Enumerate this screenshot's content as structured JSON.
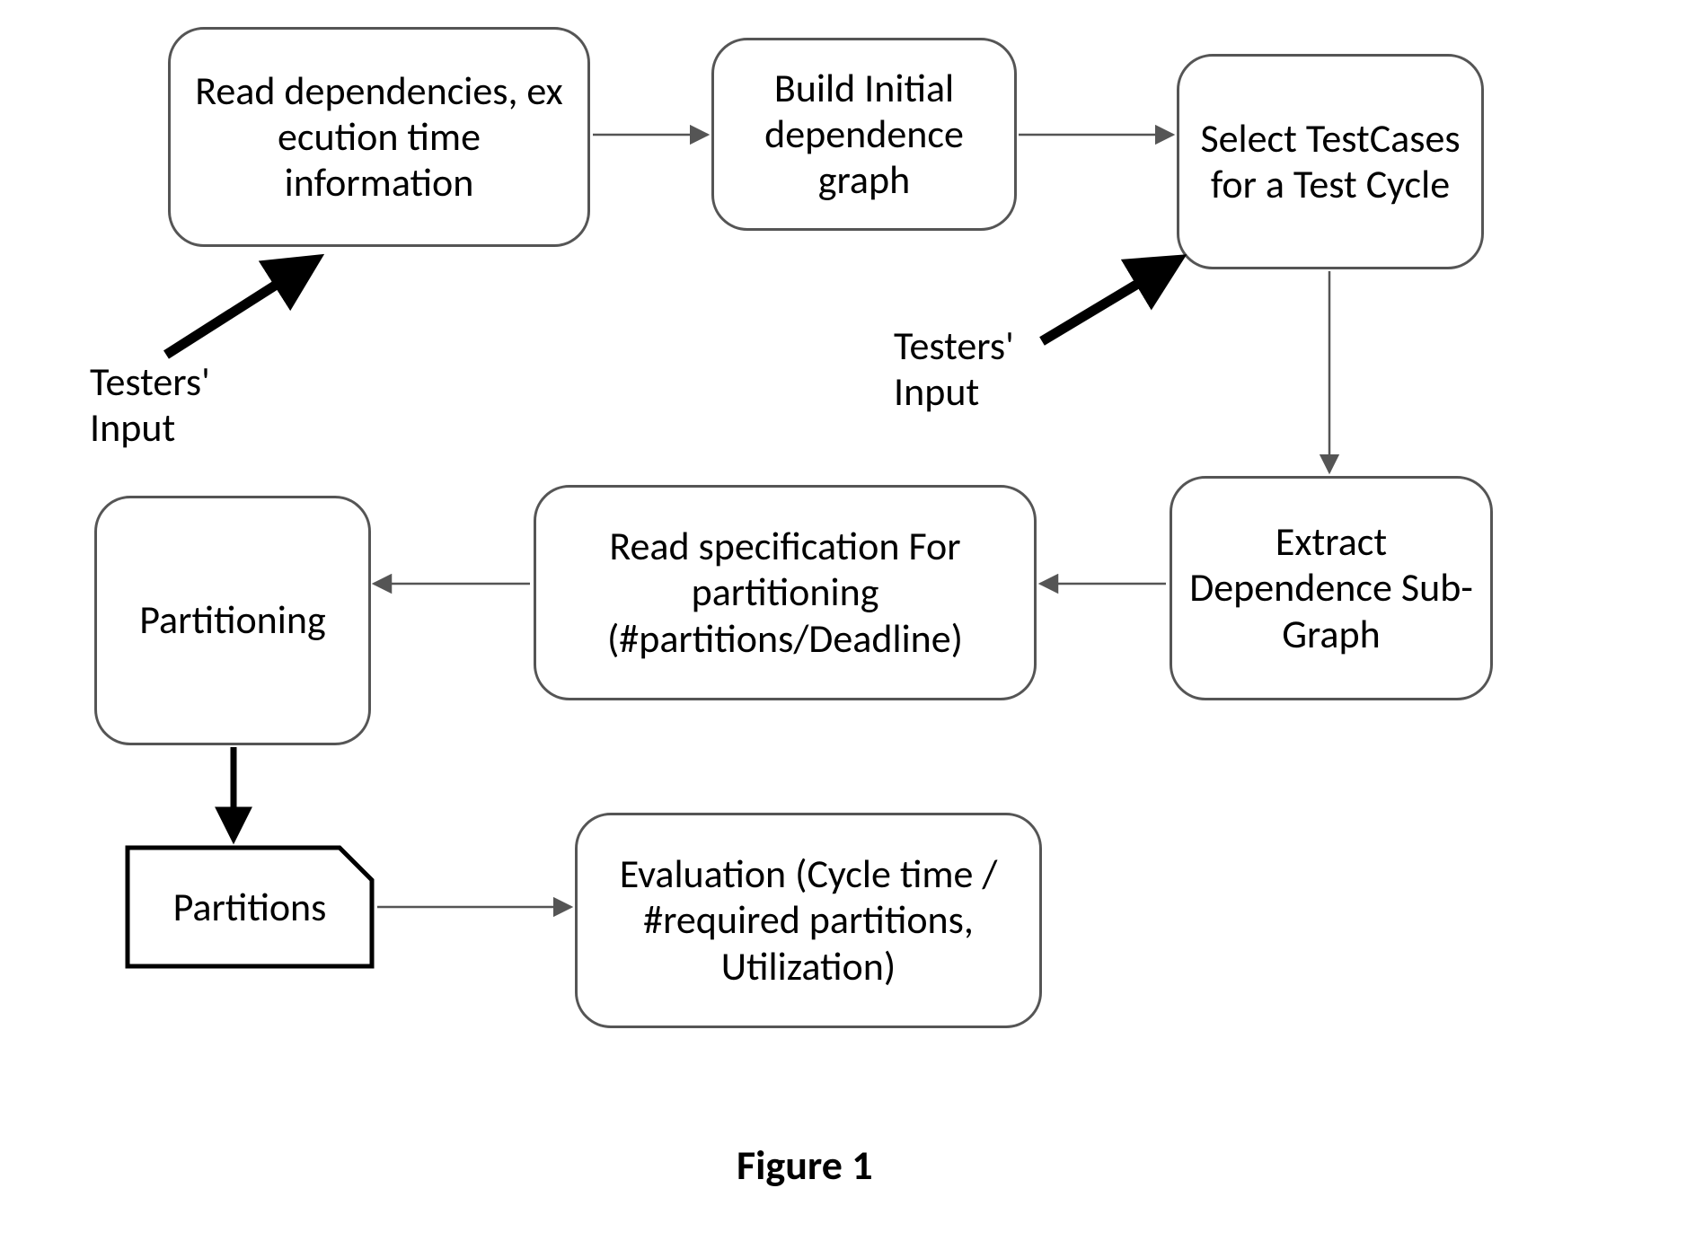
{
  "boxes": {
    "read_dep": "Read dependencies, ex ecution time information",
    "build_graph": "Build Initial dependence graph",
    "select_tc": "Select TestCases for a Test Cycle",
    "extract_sub": "Extract Dependence Sub-Graph",
    "read_spec": "Read specification For partitioning (#partitions/Deadline)",
    "partitioning": "Partitioning",
    "partitions_out": "Partitions",
    "evaluation": "Evaluation (Cycle time / #required partitions, Utilization)"
  },
  "labels": {
    "testers_input_left": "Testers' Input",
    "testers_input_right": "Testers' Input"
  },
  "caption": "Figure 1"
}
